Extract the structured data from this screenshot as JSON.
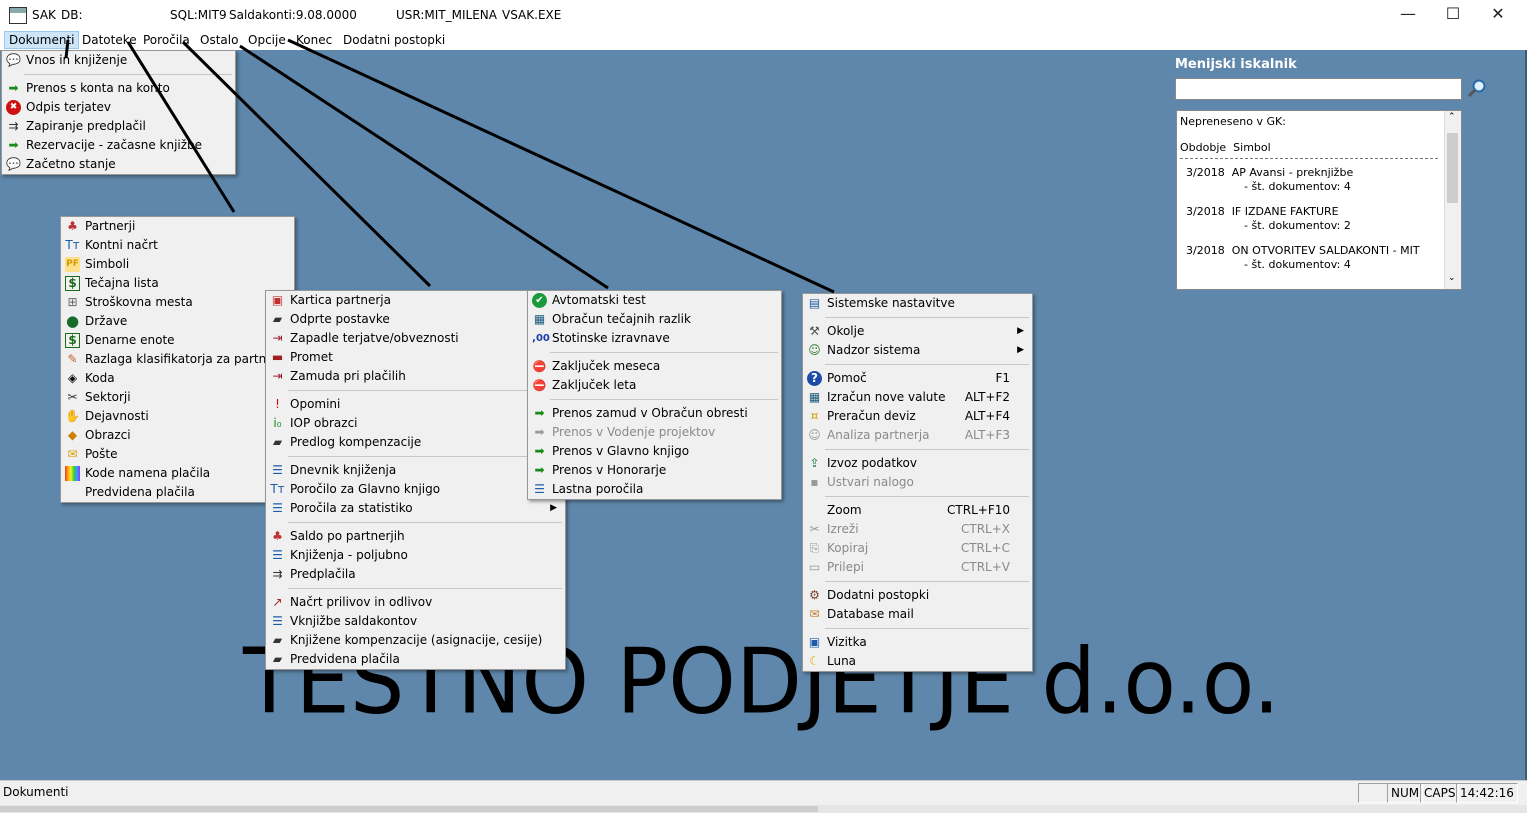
{
  "titlebar": {
    "app": "SAK",
    "db": "DB:",
    "sql": "SQL:MIT9",
    "saldakonti": "Saldakonti:9.08.0000",
    "usr": "USR:MIT_MILENA",
    "exe": "VSAK.EXE",
    "minimize": "—",
    "maximize": "☐",
    "close": "✕"
  },
  "menubar": [
    "Dokumenti",
    "Datoteke",
    "Poročila",
    "Ostalo",
    "Opcije",
    "Konec",
    "Dodatni postopki"
  ],
  "company": "TESTNO PODJETJE d.o.o.",
  "finder": {
    "title": "Menijski iskalnik",
    "input": "",
    "lines": [
      "Nepreneseno v GK:",
      "Obdobje  Simbol",
      "3/2018  AP Avansi - preknjižbe",
      "- št. dokumentov: 4",
      "3/2018  IF IZDANE FAKTURE",
      "- št. dokumentov: 2",
      "3/2018  ON OTVORITEV SALDAKONTI - MIT",
      "- št. dokumentov: 4"
    ]
  },
  "menu_dokumenti": [
    {
      "label": "Vnos in knjiženje",
      "icon": "speech-icon",
      "color": "#5a7aa0"
    },
    {
      "label": "Prenos s konta na konto",
      "icon": "green-arrow-icon",
      "color": "#1a8a1a"
    },
    {
      "label": "Odpis terjatev",
      "icon": "red-x-icon",
      "color": "#d01010"
    },
    {
      "label": "Zapiranje predplačil",
      "icon": "connect-icon",
      "color": "#333"
    },
    {
      "label": "Rezervacije - začasne knjižbe",
      "icon": "green-arrow-icon",
      "color": "#1a8a1a"
    },
    {
      "label": "Začetno stanje",
      "icon": "speech-icon",
      "color": "#5a7aa0"
    }
  ],
  "menu_datoteke": [
    {
      "label": "Partnerji",
      "icon": "partners-icon",
      "color": "#c03030"
    },
    {
      "label": "Kontni načrt",
      "icon": "tt-icon",
      "color": "#1c5ca8"
    },
    {
      "label": "Simboli",
      "icon": "pf-icon",
      "color": "#d49a00"
    },
    {
      "label": "Tečajna lista",
      "icon": "dollar-icon",
      "color": "#1a6a1a"
    },
    {
      "label": "Stroškovna mesta",
      "icon": "tree-icon",
      "color": "#666"
    },
    {
      "label": "Države",
      "icon": "globe-icon",
      "color": "#1a6a2a"
    },
    {
      "label": "Denarne enote",
      "icon": "dollar-icon",
      "color": "#1a6a1a"
    },
    {
      "label": "Razlaga klasifikatorja za partnerja",
      "icon": "pencil-icon",
      "color": "#c06020"
    },
    {
      "label": "Koda",
      "icon": "code-icon",
      "color": "#000"
    },
    {
      "label": "Sektorji",
      "icon": "tool-icon",
      "color": "#333"
    },
    {
      "label": "Dejavnosti",
      "icon": "hands-icon",
      "color": "#b04030"
    },
    {
      "label": "Obrazci",
      "icon": "forms-icon",
      "color": "#d08000"
    },
    {
      "label": "Pošte",
      "icon": "post-icon",
      "color": "#e0a000"
    },
    {
      "label": "Kode namena plačila",
      "icon": "rainbow-icon",
      "color": "#e05050"
    },
    {
      "label": "Predvidena plačila",
      "icon": "",
      "color": ""
    }
  ],
  "menu_porocila": [
    {
      "label": "Kartica partnerja",
      "icon": "card-icon",
      "color": "#c03030"
    },
    {
      "label": "Odprte postavke",
      "icon": "folder-open-icon",
      "color": "#333"
    },
    {
      "label": "Zapadle terjatve/obveznosti",
      "icon": "arrow-bar-icon",
      "color": "#a01830"
    },
    {
      "label": "Promet",
      "icon": "truck-icon",
      "color": "#a02020"
    },
    {
      "label": "Zamuda pri plačilih",
      "icon": "arrow-bar-icon",
      "color": "#a01830"
    },
    {
      "sep": true
    },
    {
      "label": "Opomini",
      "icon": "exclaim-icon",
      "color": "#d01010"
    },
    {
      "label": "IOP obrazci",
      "icon": "iop-icon",
      "color": "#1a8a1a"
    },
    {
      "label": "Predlog kompenzacije",
      "icon": "folder-open-icon",
      "color": "#333"
    },
    {
      "sep": true
    },
    {
      "label": "Dnevnik knjiženja",
      "icon": "list-icon",
      "color": "#1c5ca8"
    },
    {
      "label": "Poročilo za Glavno knjigo",
      "icon": "tt-icon",
      "color": "#1c5ca8"
    },
    {
      "label": "Poročila za statistiko",
      "icon": "list-icon",
      "color": "#1c5ca8",
      "sub": true
    },
    {
      "sep": true
    },
    {
      "label": "Saldo po partnerjih",
      "icon": "partners-icon",
      "color": "#c03030"
    },
    {
      "label": "Knjiženja - poljubno",
      "icon": "list-icon",
      "color": "#1c5ca8"
    },
    {
      "label": "Predplačila",
      "icon": "connect-icon",
      "color": "#333"
    },
    {
      "sep": true
    },
    {
      "label": "Načrt prilivov in odlivov",
      "icon": "chart-icon",
      "color": "#a02020"
    },
    {
      "label": "Vknjižbe saldakontov",
      "icon": "list-icon",
      "color": "#1c5ca8"
    },
    {
      "label": "Knjižene kompenzacije (asignacije, cesije)",
      "icon": "folder-open-icon",
      "color": "#333"
    },
    {
      "label": "Predvidena plačila",
      "icon": "folder-open-icon",
      "color": "#333"
    }
  ],
  "menu_ostalo": [
    {
      "label": "Avtomatski test",
      "icon": "check-icon",
      "color": "#1a9a3a"
    },
    {
      "label": "Obračun tečajnih razlik",
      "icon": "calc-icon",
      "color": "#1a5a7a"
    },
    {
      "label": "Stotinske izravnave",
      "icon": "decimal-icon",
      "color": "#1c3ca8",
      "glyph": ",00"
    },
    {
      "sep": true
    },
    {
      "label": "Zaključek meseca",
      "icon": "stop-icon",
      "color": "#d01010"
    },
    {
      "label": "Zaključek leta",
      "icon": "stop-icon",
      "color": "#d01010"
    },
    {
      "sep": true
    },
    {
      "label": "Prenos zamud v Obračun obresti",
      "icon": "green-arrow-icon",
      "color": "#1a8a1a"
    },
    {
      "label": "Prenos v Vodenje projektov",
      "icon": "gray-arrow-icon",
      "color": "#999",
      "dis": true
    },
    {
      "label": "Prenos v Glavno knjigo",
      "icon": "gk-arrow-icon",
      "color": "#1a8a1a"
    },
    {
      "label": "Prenos v Honorarje",
      "icon": "green-arrow-icon",
      "color": "#1a8a1a"
    },
    {
      "label": "Lastna poročila",
      "icon": "list-icon",
      "color": "#1c5ca8"
    }
  ],
  "menu_opcije": [
    {
      "label": "Sistemske nastavitve",
      "icon": "settings-icon",
      "color": "#1c5ca8"
    },
    {
      "sep": true
    },
    {
      "label": "Okolje",
      "icon": "tools-icon",
      "color": "#555",
      "sub": true
    },
    {
      "label": "Nadzor sistema",
      "icon": "users-icon",
      "color": "#2a7a2a",
      "sub": true
    },
    {
      "sep": true
    },
    {
      "label": "Pomoč",
      "icon": "help-icon",
      "color": "#1c4ca8",
      "shortcut": "F1"
    },
    {
      "label": "Izračun nove valute",
      "icon": "calc-icon",
      "color": "#1a5a7a",
      "shortcut": "ALT+F2"
    },
    {
      "label": "Preračun deviz",
      "icon": "coins-icon",
      "color": "#d0a000",
      "shortcut": "ALT+F4"
    },
    {
      "label": "Analiza partnerja",
      "icon": "user-gray-icon",
      "color": "#999",
      "shortcut": "ALT+F3",
      "dis": true
    },
    {
      "sep": true
    },
    {
      "label": "Izvoz podatkov",
      "icon": "export-icon",
      "color": "#1a7a3a"
    },
    {
      "label": "Ustvari nalogo",
      "icon": "task-gray-icon",
      "color": "#999",
      "dis": true
    },
    {
      "sep": true
    },
    {
      "label": "Zoom",
      "icon": "",
      "color": "",
      "shortcut": "CTRL+F10"
    },
    {
      "label": "Izreži",
      "icon": "scissors-icon",
      "color": "#999",
      "shortcut": "CTRL+X",
      "dis": true
    },
    {
      "label": "Kopiraj",
      "icon": "copy-icon",
      "color": "#999",
      "shortcut": "CTRL+C",
      "dis": true
    },
    {
      "label": "Prilepi",
      "icon": "paste-icon",
      "color": "#999",
      "shortcut": "CTRL+V",
      "dis": true
    },
    {
      "sep": true
    },
    {
      "label": "Dodatni postopki",
      "icon": "gear-icon",
      "color": "#7a3a2a"
    },
    {
      "label": "Database mail",
      "icon": "mail-icon",
      "color": "#c08030"
    },
    {
      "sep": true
    },
    {
      "label": "Vizitka",
      "icon": "card-icon",
      "color": "#1c5ca8"
    },
    {
      "label": "Luna",
      "icon": "moon-icon",
      "color": "#e0b000"
    }
  ],
  "status": {
    "text": "Dokumenti",
    "num": "NUM",
    "caps": "CAPS",
    "time": "14:42:16"
  }
}
